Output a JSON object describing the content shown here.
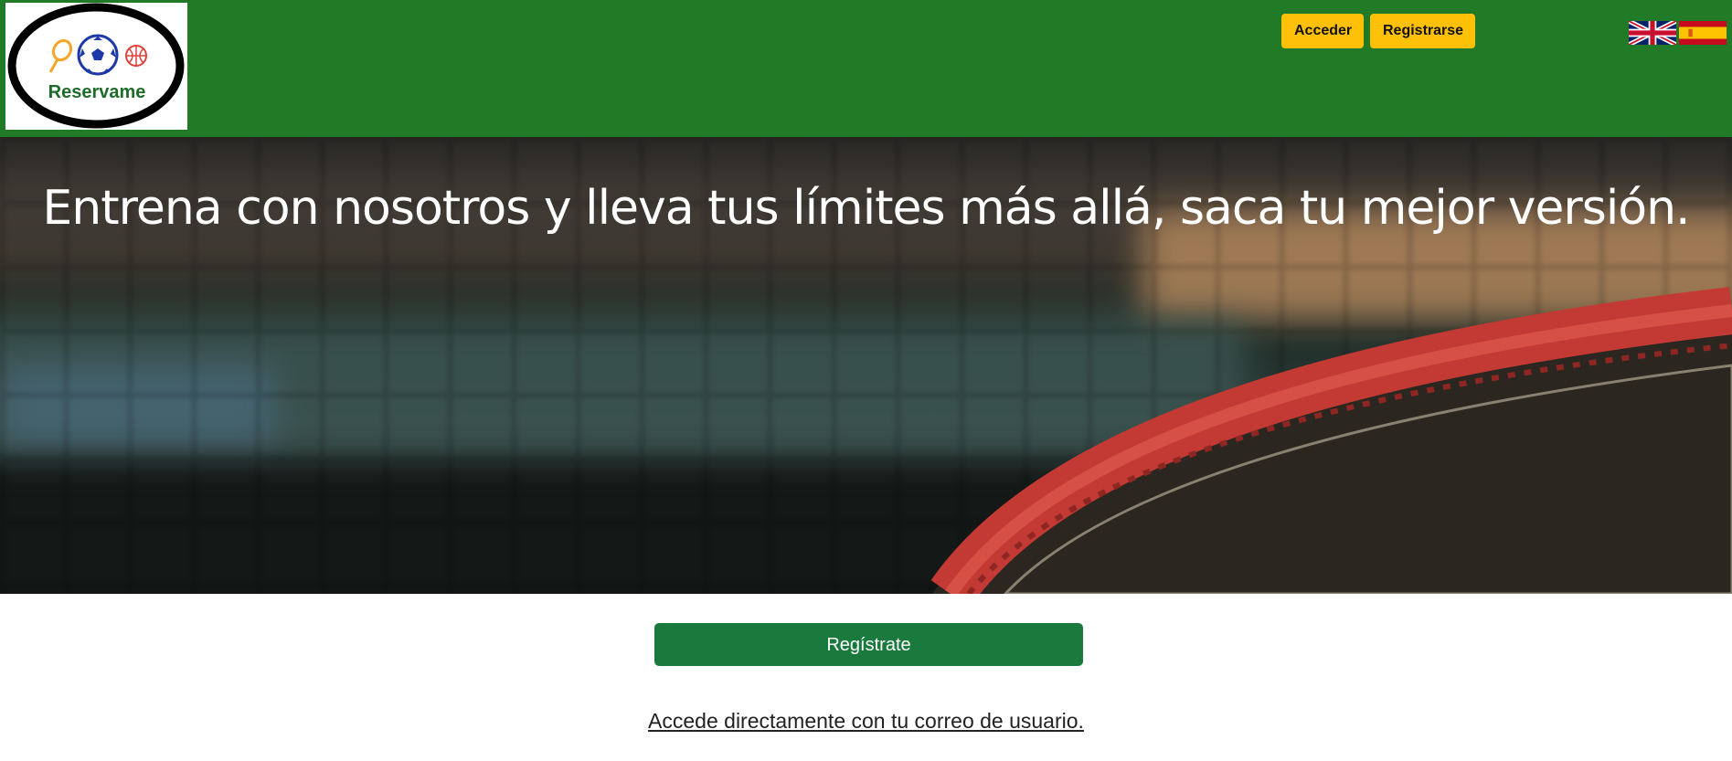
{
  "brand": {
    "logo_text": "Reservame",
    "header_color": "#217a26"
  },
  "auth": {
    "login_label": "Acceder",
    "register_label": "Registrarse",
    "button_color": "#ffc107"
  },
  "languages": [
    {
      "flag": "uk-flag-icon",
      "language": "English"
    },
    {
      "flag": "spain-flag-icon",
      "language": "Español"
    }
  ],
  "hero": {
    "title": "Entrena con nosotros y lleva tus límites más allá, saca tu mejor versión.",
    "image": "tennis-racket-net-photo"
  },
  "cta": {
    "register_label": "Regístrate",
    "register_color": "#1a7a3e",
    "login_link": "Accede directamente con tu correo de usuario."
  }
}
